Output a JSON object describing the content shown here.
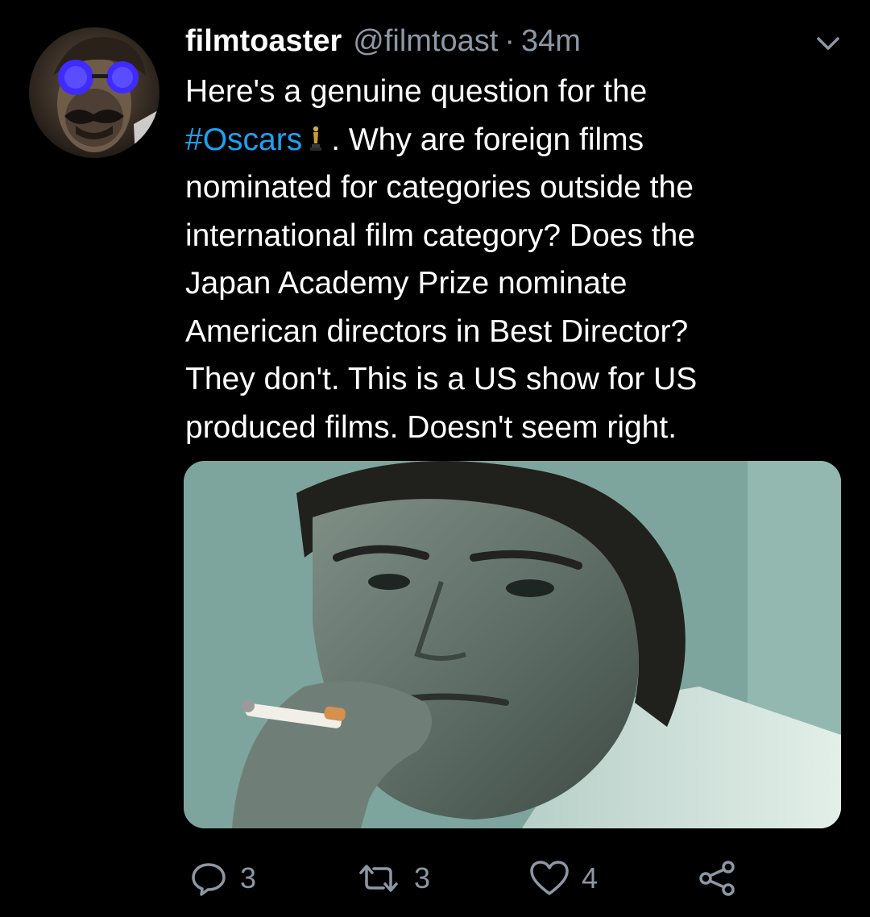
{
  "tweet": {
    "display_name": "filmtoaster",
    "handle": "@filmtoast",
    "separator": "·",
    "time": "34m",
    "text": {
      "line1": "Here's a genuine question for the",
      "hashtag": "#Oscars",
      "line2_rest": ". Why are foreign films",
      "line3": "nominated for categories outside the",
      "line4": "international film category? Does the",
      "line5": "Japan Academy Prize nominate",
      "line6": "American directors in Best Director?",
      "line7": "They don't. This is a US show for US",
      "line8": "produced films. Doesn't seem right."
    }
  },
  "actions": {
    "reply_count": "3",
    "retweet_count": "3",
    "like_count": "4"
  },
  "icons": {
    "menu": "chevron-down-icon",
    "reply": "reply-icon",
    "retweet": "retweet-icon",
    "like": "heart-icon",
    "share": "share-icon",
    "emoji": "oscar-trophy-icon"
  },
  "colors": {
    "background": "#000000",
    "text": "#ffffff",
    "secondary": "#8b98a5",
    "link": "#1da1f2"
  }
}
